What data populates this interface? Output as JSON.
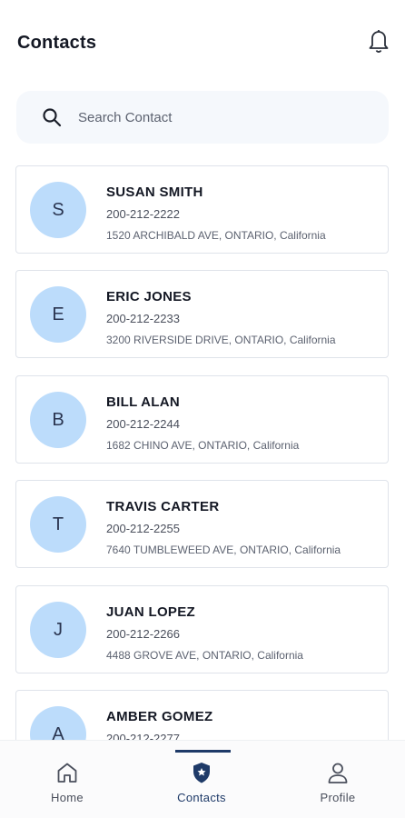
{
  "header": {
    "title": "Contacts"
  },
  "search": {
    "placeholder": "Search Contact",
    "value": ""
  },
  "contacts": [
    {
      "initial": "S",
      "name": "SUSAN SMITH",
      "phone": "200-212-2222",
      "address": "1520 ARCHIBALD AVE,  ONTARIO,  California"
    },
    {
      "initial": "E",
      "name": "ERIC JONES",
      "phone": "200-212-2233",
      "address": "3200 RIVERSIDE DRIVE,  ONTARIO,  California"
    },
    {
      "initial": "B",
      "name": "BILL ALAN",
      "phone": "200-212-2244",
      "address": "1682 CHINO AVE,  ONTARIO,  California"
    },
    {
      "initial": "T",
      "name": "TRAVIS CARTER",
      "phone": "200-212-2255",
      "address": "7640 TUMBLEWEED AVE,  ONTARIO,  California"
    },
    {
      "initial": "J",
      "name": "JUAN LOPEZ",
      "phone": "200-212-2266",
      "address": "4488 GROVE AVE,  ONTARIO,  California"
    },
    {
      "initial": "A",
      "name": "AMBER GOMEZ",
      "phone": "200-212-2277",
      "address": ""
    }
  ],
  "tabs": [
    {
      "label": "Home",
      "icon": "home-icon"
    },
    {
      "label": "Contacts",
      "icon": "shield-icon",
      "active": true
    },
    {
      "label": "Profile",
      "icon": "user-icon"
    }
  ],
  "colors": {
    "accent": "#1e3a68",
    "avatar_bg": "#bcdcfb",
    "search_bg": "#f5f8fc"
  }
}
